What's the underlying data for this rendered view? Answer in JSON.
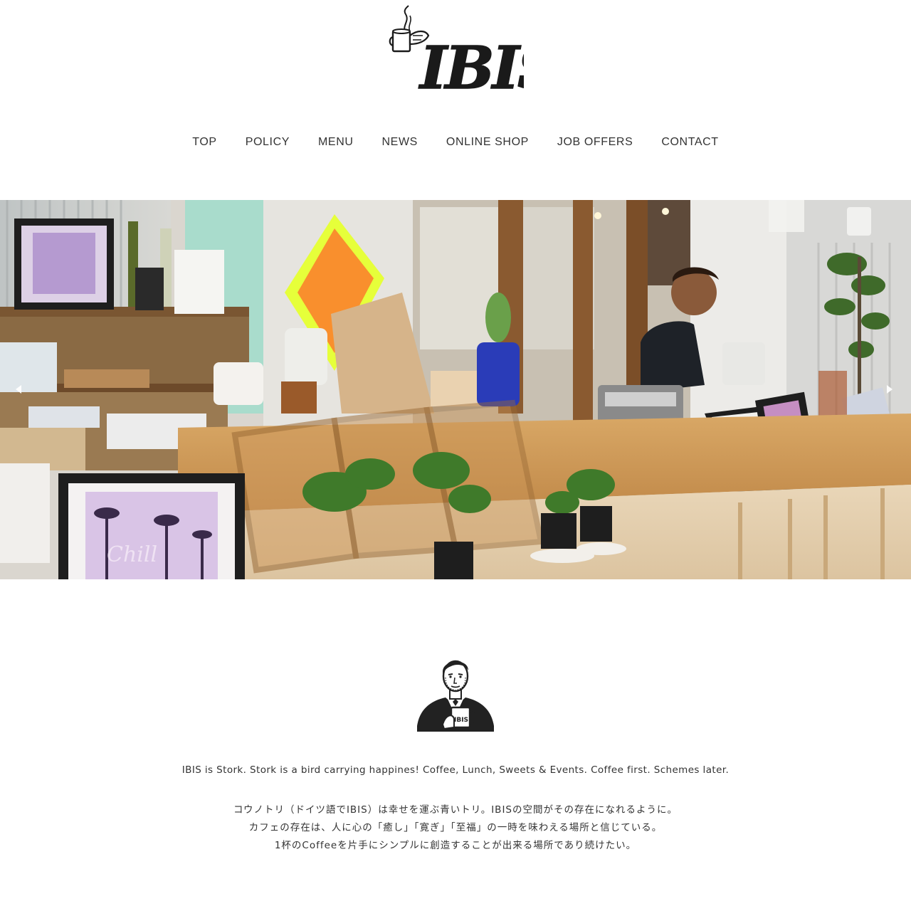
{
  "header": {
    "logo_text": "IBIS"
  },
  "nav": {
    "items": [
      {
        "label": "TOP"
      },
      {
        "label": "POLICY"
      },
      {
        "label": "MENU"
      },
      {
        "label": "NEWS"
      },
      {
        "label": "ONLINE SHOP"
      },
      {
        "label": "JOB OFFERS"
      },
      {
        "label": "CONTACT"
      }
    ]
  },
  "hero": {
    "prev_icon": "chevron-left-icon",
    "next_icon": "chevron-right-icon",
    "frame_text": "Chill"
  },
  "emblem": {
    "mug_text": "IBIS"
  },
  "intro": {
    "tagline": "IBIS is Stork. Stork is a bird carrying happines! Coffee, Lunch, Sweets & Events. Coffee first. Schemes later.",
    "lines": [
      "コウノトリ（ドイツ語でIBIS）は幸せを運ぶ青いトリ。IBISの空間がその存在になれるように。",
      "カフェの存在は、人に心の「癒し」「寛ぎ」「至福」の一時を味わえる場所と信じている。",
      "1杯のCoffeeを片手にシンプルに創造することが出来る場所であり続けたい。"
    ]
  },
  "colors": {
    "text": "#333333",
    "background": "#ffffff",
    "logo": "#1a1a1a"
  }
}
